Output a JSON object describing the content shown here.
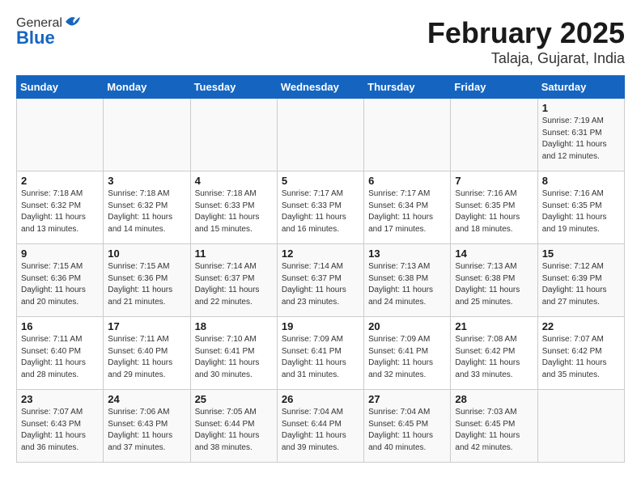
{
  "header": {
    "logo_general": "General",
    "logo_blue": "Blue",
    "month_title": "February 2025",
    "location": "Talaja, Gujarat, India"
  },
  "days_of_week": [
    "Sunday",
    "Monday",
    "Tuesday",
    "Wednesday",
    "Thursday",
    "Friday",
    "Saturday"
  ],
  "weeks": [
    [
      {
        "day": "",
        "info": ""
      },
      {
        "day": "",
        "info": ""
      },
      {
        "day": "",
        "info": ""
      },
      {
        "day": "",
        "info": ""
      },
      {
        "day": "",
        "info": ""
      },
      {
        "day": "",
        "info": ""
      },
      {
        "day": "1",
        "info": "Sunrise: 7:19 AM\nSunset: 6:31 PM\nDaylight: 11 hours\nand 12 minutes."
      }
    ],
    [
      {
        "day": "2",
        "info": "Sunrise: 7:18 AM\nSunset: 6:32 PM\nDaylight: 11 hours\nand 13 minutes."
      },
      {
        "day": "3",
        "info": "Sunrise: 7:18 AM\nSunset: 6:32 PM\nDaylight: 11 hours\nand 14 minutes."
      },
      {
        "day": "4",
        "info": "Sunrise: 7:18 AM\nSunset: 6:33 PM\nDaylight: 11 hours\nand 15 minutes."
      },
      {
        "day": "5",
        "info": "Sunrise: 7:17 AM\nSunset: 6:33 PM\nDaylight: 11 hours\nand 16 minutes."
      },
      {
        "day": "6",
        "info": "Sunrise: 7:17 AM\nSunset: 6:34 PM\nDaylight: 11 hours\nand 17 minutes."
      },
      {
        "day": "7",
        "info": "Sunrise: 7:16 AM\nSunset: 6:35 PM\nDaylight: 11 hours\nand 18 minutes."
      },
      {
        "day": "8",
        "info": "Sunrise: 7:16 AM\nSunset: 6:35 PM\nDaylight: 11 hours\nand 19 minutes."
      }
    ],
    [
      {
        "day": "9",
        "info": "Sunrise: 7:15 AM\nSunset: 6:36 PM\nDaylight: 11 hours\nand 20 minutes."
      },
      {
        "day": "10",
        "info": "Sunrise: 7:15 AM\nSunset: 6:36 PM\nDaylight: 11 hours\nand 21 minutes."
      },
      {
        "day": "11",
        "info": "Sunrise: 7:14 AM\nSunset: 6:37 PM\nDaylight: 11 hours\nand 22 minutes."
      },
      {
        "day": "12",
        "info": "Sunrise: 7:14 AM\nSunset: 6:37 PM\nDaylight: 11 hours\nand 23 minutes."
      },
      {
        "day": "13",
        "info": "Sunrise: 7:13 AM\nSunset: 6:38 PM\nDaylight: 11 hours\nand 24 minutes."
      },
      {
        "day": "14",
        "info": "Sunrise: 7:13 AM\nSunset: 6:38 PM\nDaylight: 11 hours\nand 25 minutes."
      },
      {
        "day": "15",
        "info": "Sunrise: 7:12 AM\nSunset: 6:39 PM\nDaylight: 11 hours\nand 27 minutes."
      }
    ],
    [
      {
        "day": "16",
        "info": "Sunrise: 7:11 AM\nSunset: 6:40 PM\nDaylight: 11 hours\nand 28 minutes."
      },
      {
        "day": "17",
        "info": "Sunrise: 7:11 AM\nSunset: 6:40 PM\nDaylight: 11 hours\nand 29 minutes."
      },
      {
        "day": "18",
        "info": "Sunrise: 7:10 AM\nSunset: 6:41 PM\nDaylight: 11 hours\nand 30 minutes."
      },
      {
        "day": "19",
        "info": "Sunrise: 7:09 AM\nSunset: 6:41 PM\nDaylight: 11 hours\nand 31 minutes."
      },
      {
        "day": "20",
        "info": "Sunrise: 7:09 AM\nSunset: 6:41 PM\nDaylight: 11 hours\nand 32 minutes."
      },
      {
        "day": "21",
        "info": "Sunrise: 7:08 AM\nSunset: 6:42 PM\nDaylight: 11 hours\nand 33 minutes."
      },
      {
        "day": "22",
        "info": "Sunrise: 7:07 AM\nSunset: 6:42 PM\nDaylight: 11 hours\nand 35 minutes."
      }
    ],
    [
      {
        "day": "23",
        "info": "Sunrise: 7:07 AM\nSunset: 6:43 PM\nDaylight: 11 hours\nand 36 minutes."
      },
      {
        "day": "24",
        "info": "Sunrise: 7:06 AM\nSunset: 6:43 PM\nDaylight: 11 hours\nand 37 minutes."
      },
      {
        "day": "25",
        "info": "Sunrise: 7:05 AM\nSunset: 6:44 PM\nDaylight: 11 hours\nand 38 minutes."
      },
      {
        "day": "26",
        "info": "Sunrise: 7:04 AM\nSunset: 6:44 PM\nDaylight: 11 hours\nand 39 minutes."
      },
      {
        "day": "27",
        "info": "Sunrise: 7:04 AM\nSunset: 6:45 PM\nDaylight: 11 hours\nand 40 minutes."
      },
      {
        "day": "28",
        "info": "Sunrise: 7:03 AM\nSunset: 6:45 PM\nDaylight: 11 hours\nand 42 minutes."
      },
      {
        "day": "",
        "info": ""
      }
    ]
  ]
}
